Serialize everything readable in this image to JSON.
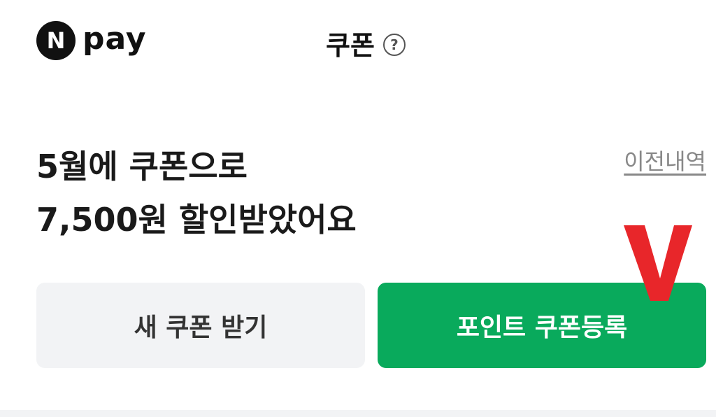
{
  "header": {
    "logo_letter": "N",
    "logo_text": "pay",
    "title": "쿠폰",
    "help_symbol": "?"
  },
  "summary": {
    "line1": "5월에 쿠폰으로",
    "line2": "7,500원 할인받았어요",
    "history_link": "이전내역"
  },
  "buttons": {
    "new_coupon": "새 쿠폰 받기",
    "register_coupon": "포인트 쿠폰등록"
  },
  "annotation": {
    "mark": "V",
    "color": "#e8262a"
  },
  "colors": {
    "brand_green": "#09aa5c",
    "secondary_bg": "#f2f3f5"
  }
}
